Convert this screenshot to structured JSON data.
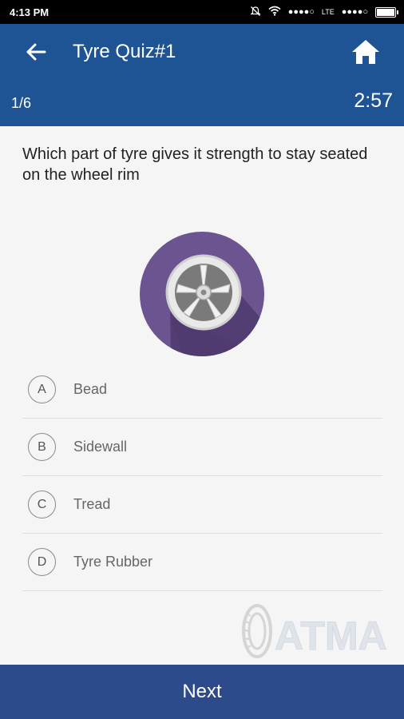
{
  "status_bar": {
    "time": "4:13 PM",
    "signal_dots_1": "●●●●○",
    "network_label": "LTE",
    "signal_dots_2": "●●●●○"
  },
  "header": {
    "title": "Tyre Quiz#1",
    "progress": "1/6",
    "timer": "2:57",
    "background_color": "#1f5494"
  },
  "question": {
    "text": "Which part of tyre gives it strength to stay seated on the wheel rim",
    "image_icon": "wheel-rim-icon"
  },
  "options": [
    {
      "letter": "A",
      "label": "Bead"
    },
    {
      "letter": "B",
      "label": "Sidewall"
    },
    {
      "letter": "C",
      "label": "Tread"
    },
    {
      "letter": "D",
      "label": "Tyre Rubber"
    }
  ],
  "watermark": {
    "logo_text": "ATMA"
  },
  "footer": {
    "next_label": "Next",
    "background_color": "#2d4a8a"
  },
  "icons": {
    "back": "arrow-left-icon",
    "home": "home-icon",
    "mute": "mute-icon",
    "wifi": "wifi-icon",
    "battery": "battery-icon"
  }
}
